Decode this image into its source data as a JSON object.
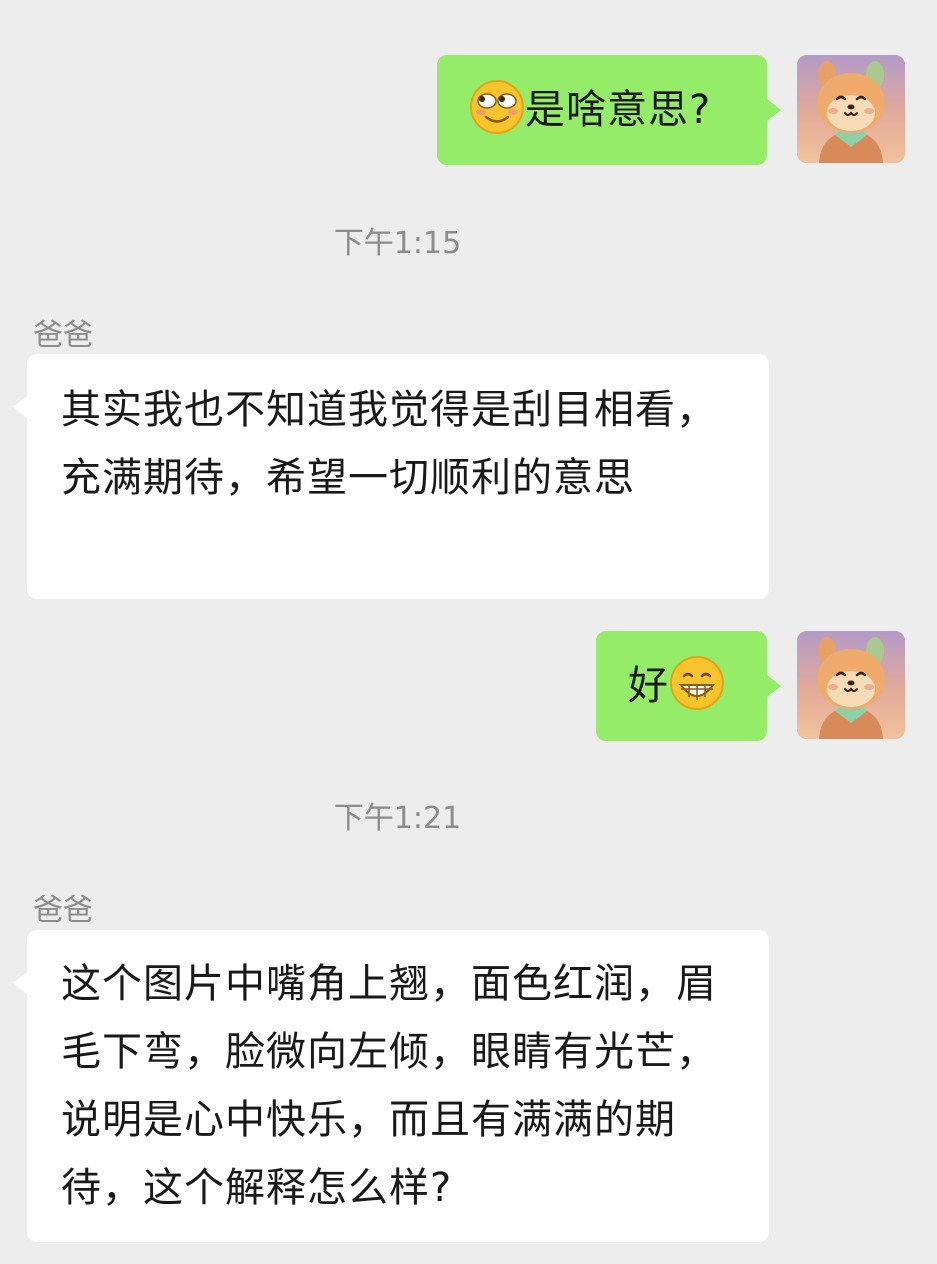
{
  "chat": {
    "messages": [
      {
        "type": "self",
        "emoji": "rolling-eyes-smile-emoji",
        "text": "是啥意思?"
      },
      {
        "type": "timestamp",
        "text": "下午1:15"
      },
      {
        "type": "other",
        "sender": "爸爸",
        "text": "其实我也不知道我觉得是刮目相看，充满期待，希望一切顺利的意思"
      },
      {
        "type": "self",
        "text": "好",
        "emoji": "grinning-teeth-emoji"
      },
      {
        "type": "timestamp",
        "text": "下午1:21"
      },
      {
        "type": "other",
        "sender": "爸爸",
        "text": "这个图片中嘴角上翘，面色红润，眉毛下弯，脸微向左倾，眼睛有光芒，说明是心中快乐，而且有满满的期待，这个解释怎么样?"
      }
    ]
  },
  "colors": {
    "background": "#ededed",
    "self_bubble": "#95ec69",
    "other_bubble": "#ffffff",
    "meta_text": "#8c8c8c"
  }
}
